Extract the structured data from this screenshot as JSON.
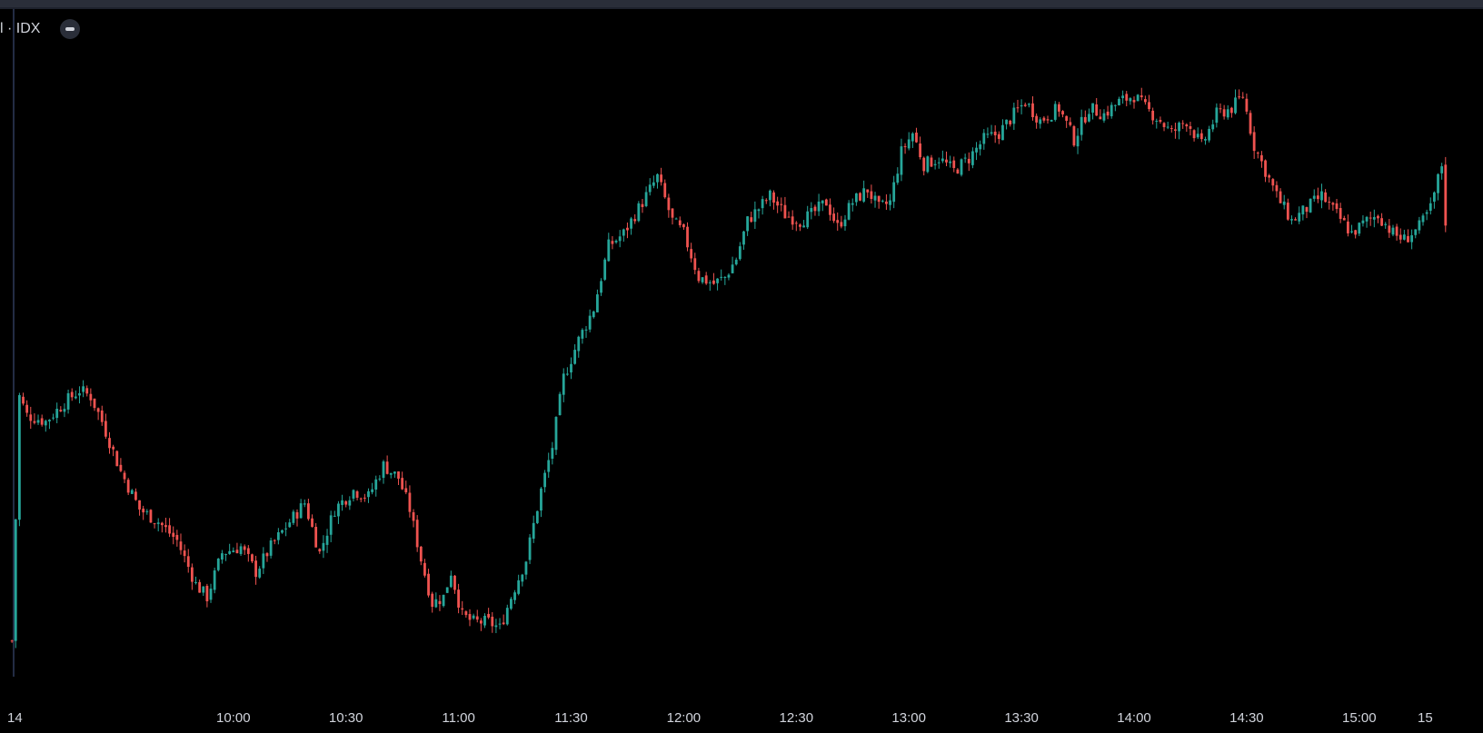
{
  "legend": {
    "symbol_fragment": "l · IDX",
    "collapse_icon": "minus-icon"
  },
  "colors": {
    "background": "#000000",
    "up": "#26a69a",
    "down": "#ef5350",
    "text": "#d1d4dc",
    "crosshair_line": "#2f3a5a"
  },
  "time_axis": {
    "labels": [
      "14",
      "10:00",
      "10:30",
      "11:00",
      "11:30",
      "12:00",
      "12:30",
      "13:00",
      "13:30",
      "14:00",
      "14:30",
      "15:00",
      "15"
    ]
  },
  "chart_data": {
    "type": "candlestick",
    "interval_minutes": 1,
    "session_open_time": "09:00",
    "price_axis_visible": false,
    "x_axis_labels": [
      "14",
      "10:00",
      "10:30",
      "11:00",
      "11:30",
      "12:00",
      "12:30",
      "13:00",
      "13:30",
      "14:00",
      "14:30",
      "15:00",
      "15"
    ],
    "relative_close_path": {
      "note_units": "relative price level 0-100 (no price scale visible)",
      "points": [
        [
          "09:01",
          5
        ],
        [
          "09:03",
          44
        ],
        [
          "09:05",
          41
        ],
        [
          "09:10",
          40
        ],
        [
          "09:15",
          43
        ],
        [
          "09:19",
          45
        ],
        [
          "09:22",
          44
        ],
        [
          "09:25",
          40
        ],
        [
          "09:30",
          32
        ],
        [
          "09:35",
          26
        ],
        [
          "09:40",
          24
        ],
        [
          "09:45",
          21
        ],
        [
          "09:50",
          14
        ],
        [
          "09:53",
          12
        ],
        [
          "09:57",
          19
        ],
        [
          "10:02",
          20
        ],
        [
          "10:06",
          16
        ],
        [
          "10:10",
          20
        ],
        [
          "10:15",
          24
        ],
        [
          "10:19",
          27
        ],
        [
          "10:23",
          19
        ],
        [
          "10:27",
          26
        ],
        [
          "10:32",
          29
        ],
        [
          "10:36",
          28
        ],
        [
          "10:40",
          33
        ],
        [
          "10:44",
          31
        ],
        [
          "10:47",
          26
        ],
        [
          "10:50",
          18
        ],
        [
          "10:53",
          11
        ],
        [
          "10:56",
          12
        ],
        [
          "10:58",
          16
        ],
        [
          "11:01",
          9
        ],
        [
          "11:04",
          8
        ],
        [
          "11:08",
          8
        ],
        [
          "11:11",
          7
        ],
        [
          "11:14",
          12
        ],
        [
          "11:18",
          18
        ],
        [
          "11:22",
          29
        ],
        [
          "11:25",
          36
        ],
        [
          "11:28",
          47
        ],
        [
          "11:32",
          53
        ],
        [
          "11:36",
          58
        ],
        [
          "11:40",
          68
        ],
        [
          "11:44",
          70
        ],
        [
          "11:47",
          73
        ],
        [
          "11:50",
          76
        ],
        [
          "11:53",
          79
        ],
        [
          "11:57",
          72
        ],
        [
          "12:00",
          70
        ],
        [
          "12:04",
          63
        ],
        [
          "12:08",
          62
        ],
        [
          "12:11",
          63
        ],
        [
          "12:14",
          66
        ],
        [
          "12:17",
          72
        ],
        [
          "12:20",
          74
        ],
        [
          "12:23",
          76
        ],
        [
          "12:27",
          73
        ],
        [
          "12:31",
          72
        ],
        [
          "12:34",
          73
        ],
        [
          "12:38",
          75
        ],
        [
          "12:41",
          71
        ],
        [
          "12:45",
          75
        ],
        [
          "12:49",
          77
        ],
        [
          "12:52",
          74
        ],
        [
          "12:55",
          75
        ],
        [
          "12:58",
          83
        ],
        [
          "13:01",
          86
        ],
        [
          "13:04",
          81
        ],
        [
          "13:08",
          82
        ],
        [
          "13:12",
          80
        ],
        [
          "13:16",
          82
        ],
        [
          "13:20",
          85
        ],
        [
          "13:24",
          86
        ],
        [
          "13:28",
          89
        ],
        [
          "13:31",
          91
        ],
        [
          "13:35",
          88
        ],
        [
          "13:40",
          90
        ],
        [
          "13:44",
          85
        ],
        [
          "13:48",
          90
        ],
        [
          "13:52",
          89
        ],
        [
          "13:56",
          91
        ],
        [
          "14:00",
          92
        ],
        [
          "14:03",
          90
        ],
        [
          "14:07",
          88
        ],
        [
          "14:10",
          86
        ],
        [
          "14:14",
          88
        ],
        [
          "14:18",
          84
        ],
        [
          "14:22",
          89
        ],
        [
          "14:26",
          90
        ],
        [
          "14:29",
          92
        ],
        [
          "14:32",
          84
        ],
        [
          "14:35",
          80
        ],
        [
          "14:38",
          76
        ],
        [
          "14:42",
          72
        ],
        [
          "14:46",
          74
        ],
        [
          "14:50",
          76
        ],
        [
          "14:54",
          73
        ],
        [
          "14:58",
          70
        ],
        [
          "15:02",
          72
        ],
        [
          "15:05",
          73
        ],
        [
          "15:09",
          70
        ],
        [
          "15:12",
          69
        ],
        [
          "15:16",
          71
        ],
        [
          "15:19",
          74
        ],
        [
          "15:22",
          81
        ],
        [
          "15:23",
          72
        ]
      ]
    }
  }
}
